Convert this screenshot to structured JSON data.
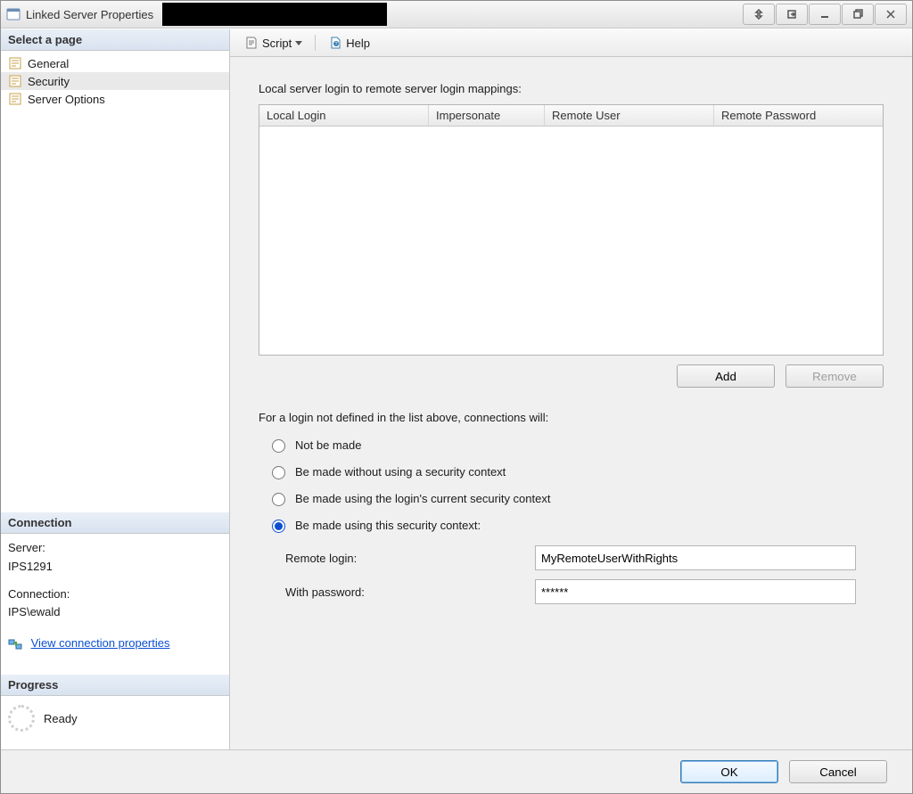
{
  "window": {
    "title": "Linked Server Properties"
  },
  "win_controls": {
    "pin": "pin",
    "pop": "popout",
    "min": "minimize",
    "max": "restore",
    "close": "close"
  },
  "sidebar": {
    "header": "Select a page",
    "pages": [
      {
        "label": "General",
        "selected": false
      },
      {
        "label": "Security",
        "selected": true
      },
      {
        "label": "Server Options",
        "selected": false
      }
    ],
    "connection": {
      "header": "Connection",
      "server_label": "Server:",
      "server_value": "IPS1291",
      "conn_label": "Connection:",
      "conn_value": "IPS\\ewald",
      "view_link": "View connection properties"
    },
    "progress": {
      "header": "Progress",
      "status": "Ready"
    }
  },
  "toolbar": {
    "script": "Script",
    "help": "Help"
  },
  "mappings": {
    "label": "Local server login to remote server login mappings:",
    "columns": [
      "Local Login",
      "Impersonate",
      "Remote User",
      "Remote Password"
    ],
    "rows": [],
    "add": "Add",
    "remove": "Remove"
  },
  "undef": {
    "label": "For a login not defined in the list above, connections will:",
    "options": [
      "Not be made",
      "Be made without using a security context",
      "Be made using the login's current security context",
      "Be made using this security context:"
    ],
    "selected_index": 3,
    "remote_login_label": "Remote login:",
    "remote_login_value": "MyRemoteUserWithRights",
    "password_label": "With password:",
    "password_value": "******"
  },
  "footer": {
    "ok": "OK",
    "cancel": "Cancel"
  }
}
